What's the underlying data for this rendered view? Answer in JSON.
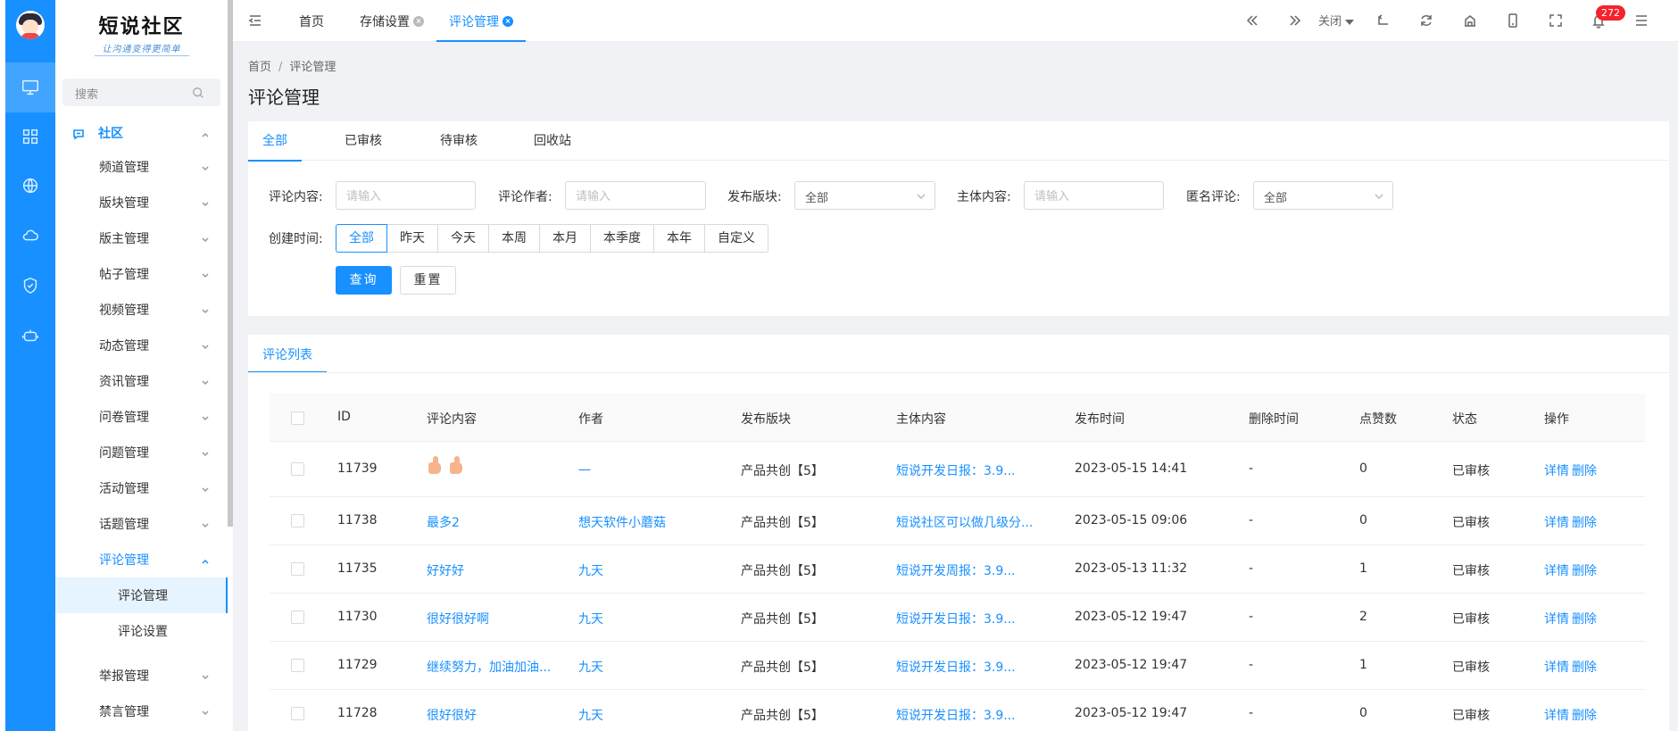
{
  "sidebar": {
    "logo_title": "短说社区",
    "logo_sub": "让沟通变得更简单",
    "search_placeholder": "搜索",
    "root": "社区",
    "items": [
      {
        "label": "频道管理"
      },
      {
        "label": "版块管理"
      },
      {
        "label": "版主管理"
      },
      {
        "label": "帖子管理"
      },
      {
        "label": "视频管理"
      },
      {
        "label": "动态管理"
      },
      {
        "label": "资讯管理"
      },
      {
        "label": "问卷管理"
      },
      {
        "label": "问题管理"
      },
      {
        "label": "活动管理"
      },
      {
        "label": "话题管理"
      },
      {
        "label": "评论管理"
      }
    ],
    "sub_items": [
      {
        "label": "评论管理"
      },
      {
        "label": "评论设置"
      }
    ],
    "after_items": [
      {
        "label": "举报管理"
      },
      {
        "label": "禁言管理"
      }
    ]
  },
  "topbar": {
    "tabs": [
      {
        "label": "首页"
      },
      {
        "label": "存储设置"
      },
      {
        "label": "评论管理"
      }
    ],
    "close_label": "关闭",
    "notification_count": "272"
  },
  "page": {
    "breadcrumb": [
      "首页",
      "评论管理"
    ],
    "title": "评论管理"
  },
  "status_tabs": [
    "全部",
    "已审核",
    "待审核",
    "回收站"
  ],
  "filters": {
    "content_label": "评论内容:",
    "content_placeholder": "请输入",
    "author_label": "评论作者:",
    "author_placeholder": "请输入",
    "block_label": "发布版块:",
    "block_value": "全部",
    "subject_label": "主体内容:",
    "subject_placeholder": "请输入",
    "anon_label": "匿名评论:",
    "anon_value": "全部",
    "time_label": "创建时间:",
    "time_options": [
      "全部",
      "昨天",
      "今天",
      "本周",
      "本月",
      "本季度",
      "本年",
      "自定义"
    ],
    "query_button": "查询",
    "reset_button": "重置"
  },
  "list": {
    "tab_label": "评论列表",
    "headers": [
      "ID",
      "评论内容",
      "作者",
      "发布版块",
      "主体内容",
      "发布时间",
      "删除时间",
      "点赞数",
      "状态",
      "操作"
    ],
    "rows": [
      {
        "id": "11739",
        "content": "",
        "content_emoji": "thumbs-up x2",
        "author": "一",
        "block": "产品共创【5】",
        "subject": "短说开发日报：3.9...",
        "time": "2023-05-15 14:41",
        "deleted": "-",
        "likes": "0",
        "status": "已审核",
        "detail": "详情",
        "delete": "删除"
      },
      {
        "id": "11738",
        "content": "最多2",
        "author": "想天软件小蘑菇",
        "block": "产品共创【5】",
        "subject": "短说社区可以做几级分...",
        "time": "2023-05-15 09:06",
        "deleted": "-",
        "likes": "0",
        "status": "已审核",
        "detail": "详情",
        "delete": "删除"
      },
      {
        "id": "11735",
        "content": "好好好",
        "author": "九天",
        "block": "产品共创【5】",
        "subject": "短说开发周报：3.9...",
        "time": "2023-05-13 11:32",
        "deleted": "-",
        "likes": "1",
        "status": "已审核",
        "detail": "详情",
        "delete": "删除"
      },
      {
        "id": "11730",
        "content": "很好很好啊",
        "author": "九天",
        "block": "产品共创【5】",
        "subject": "短说开发日报：3.9...",
        "time": "2023-05-12 19:47",
        "deleted": "-",
        "likes": "2",
        "status": "已审核",
        "detail": "详情",
        "delete": "删除"
      },
      {
        "id": "11729",
        "content": "继续努力，加油加油...",
        "author": "九天",
        "block": "产品共创【5】",
        "subject": "短说开发日报：3.9...",
        "time": "2023-05-12 19:47",
        "deleted": "-",
        "likes": "1",
        "status": "已审核",
        "detail": "详情",
        "delete": "删除"
      },
      {
        "id": "11728",
        "content": "很好很好",
        "author": "九天",
        "block": "产品共创【5】",
        "subject": "短说开发日报：3.9...",
        "time": "2023-05-12 19:47",
        "deleted": "-",
        "likes": "0",
        "status": "已审核",
        "detail": "详情",
        "delete": "删除"
      }
    ]
  },
  "colors": {
    "primary": "#1890ff",
    "badge": "#f5222d",
    "content_bg": "#f0f2f5"
  }
}
